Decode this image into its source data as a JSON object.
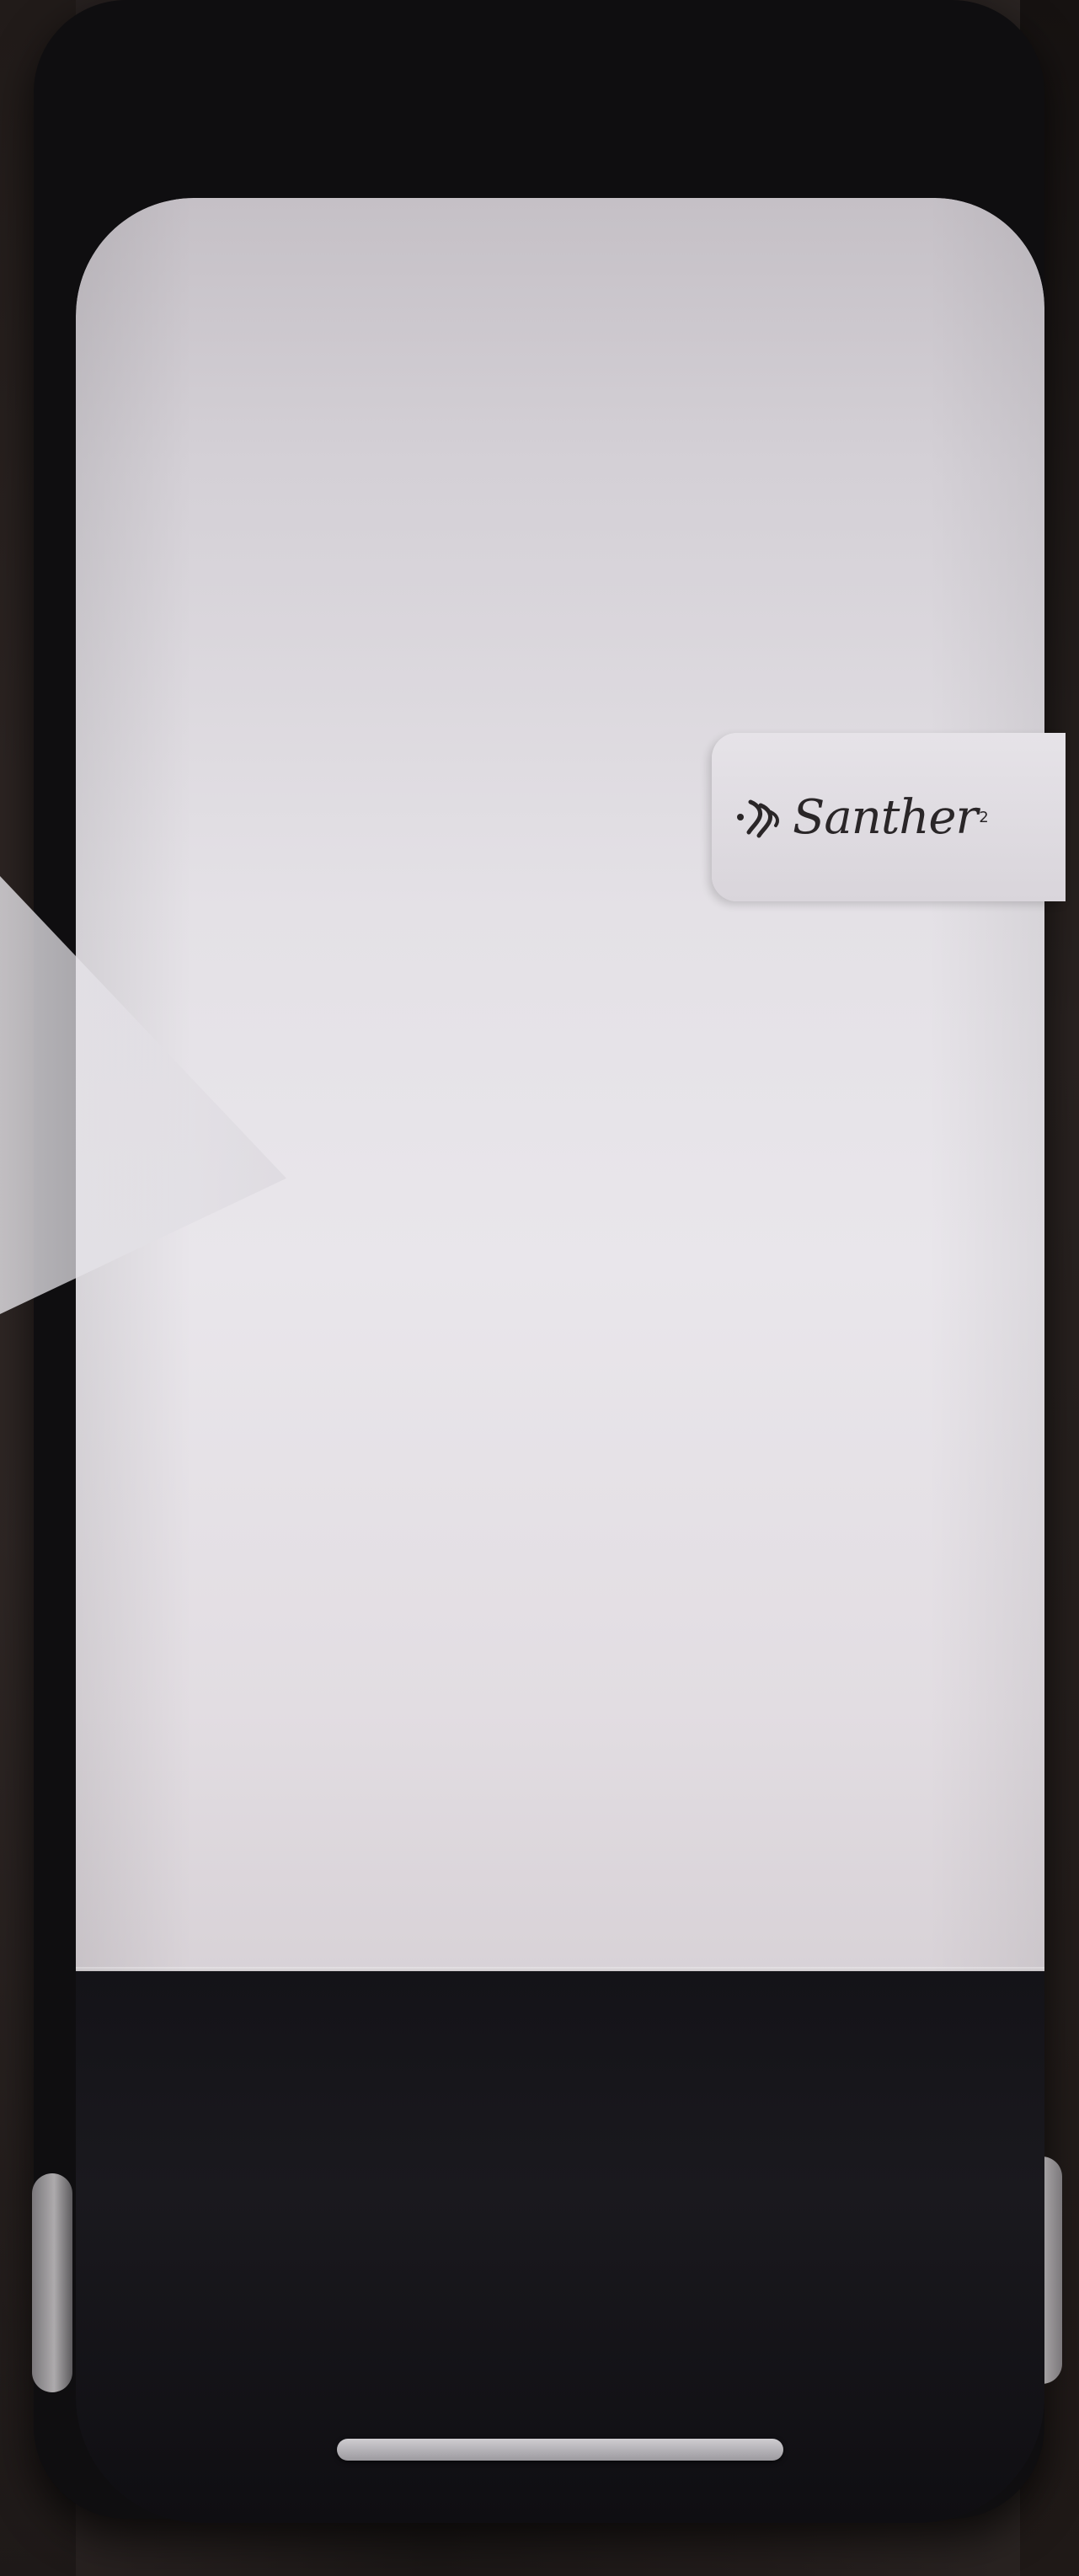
{
  "scene": {
    "subject": "wall-mounted-dispenser"
  },
  "logo": {
    "brand": "Santher",
    "mark": "2"
  },
  "colors": {
    "cover": "#e4e1e6",
    "base": "#141318",
    "background": "#1f1a19"
  }
}
